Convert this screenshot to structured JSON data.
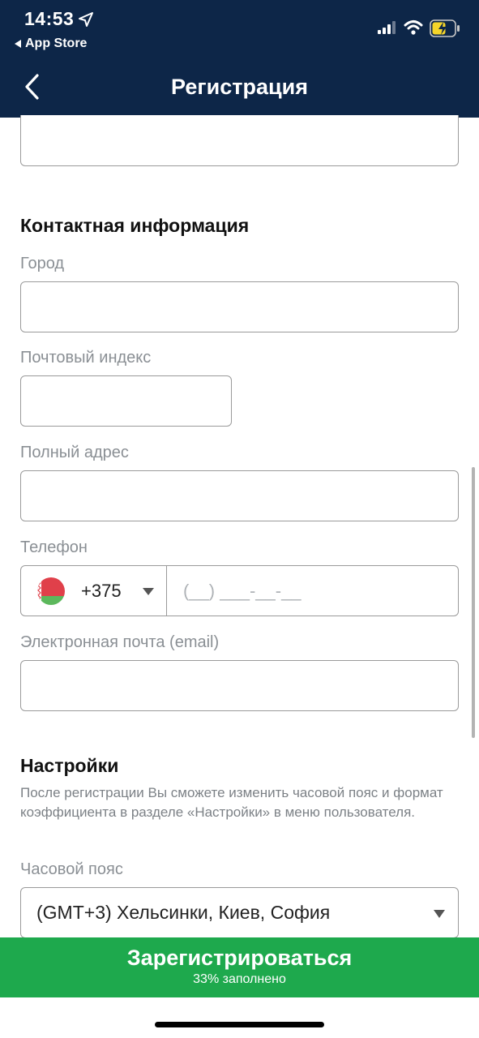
{
  "status_bar": {
    "time": "14:53",
    "back_app": "App Store"
  },
  "nav": {
    "title": "Регистрация"
  },
  "contact": {
    "section_title": "Контактная информация",
    "city_label": "Город",
    "zip_label": "Почтовый индекс",
    "address_label": "Полный адрес",
    "phone_label": "Телефон",
    "phone_code": "+375",
    "phone_placeholder": "(__) ___-__-__",
    "email_label": "Электронная почта (email)"
  },
  "settings": {
    "section_title": "Настройки",
    "hint": "После регистрации Вы сможете изменить часовой пояс и формат коэффициента в разделе «Настройки» в меню пользователя.",
    "timezone_label": "Часовой пояс",
    "timezone_value": "(GMT+3) Хельсинки, Киев, София"
  },
  "register": {
    "label": "Зарегистрироваться",
    "progress_text": "33% заполнено",
    "progress": 0.33
  },
  "colors": {
    "header_bg": "#0d2648",
    "register_bg": "#1ea94d",
    "battery_fill": "#f5d52a"
  }
}
